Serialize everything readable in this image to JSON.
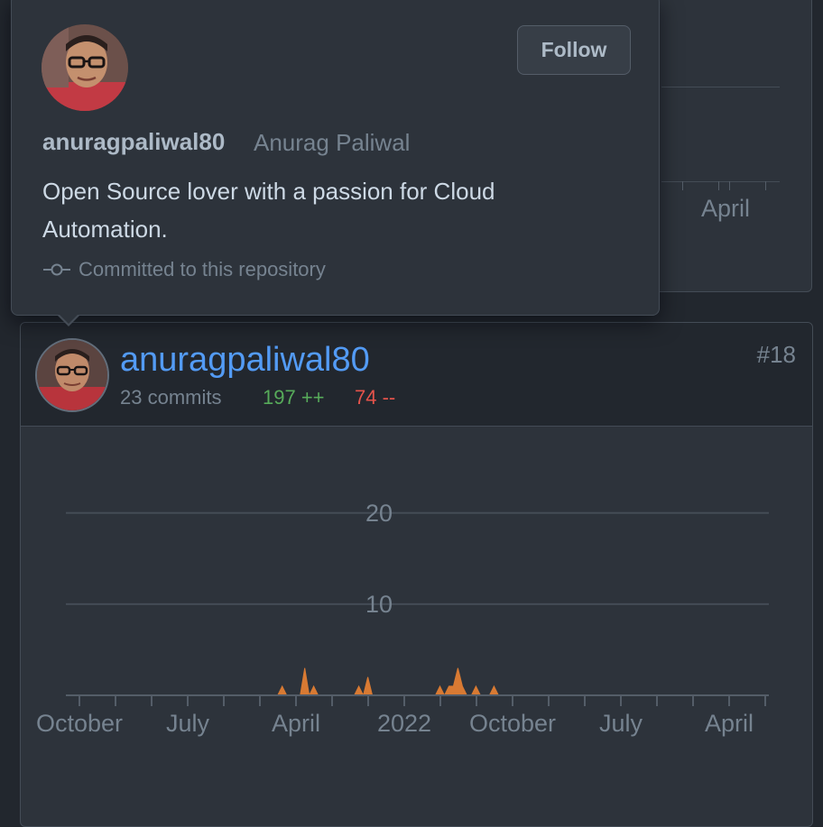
{
  "popover": {
    "login": "anuragpaliwal80",
    "name": "Anurag Paliwal",
    "bio": "Open Source lover with a passion for Cloud Automation.",
    "follow_label": "Follow",
    "commit_note": "Committed to this repository"
  },
  "background_card": {
    "month_label": "April"
  },
  "contributor": {
    "username": "anuragpaliwal80",
    "commits": "23 commits",
    "additions": "197 ++",
    "deletions": "74 --",
    "rank": "#18"
  },
  "colors": {
    "link": "#539bf5",
    "additions": "#57ab5a",
    "deletions": "#e5534b",
    "area": "#d87a33"
  },
  "chart_data": {
    "type": "area",
    "ylim": [
      0,
      25
    ],
    "y_ticks": [
      10,
      20
    ],
    "x_labels": [
      "October",
      "July",
      "April",
      "2022",
      "October",
      "July",
      "April"
    ],
    "x": [
      0,
      1,
      2,
      3,
      4,
      5,
      6,
      7,
      8,
      9,
      10,
      11,
      12,
      13,
      14,
      15,
      16,
      17,
      18,
      19,
      20,
      21,
      22,
      23,
      24,
      25,
      26,
      27,
      28,
      29,
      30,
      31,
      32,
      33,
      34,
      35,
      36,
      37,
      38,
      39,
      40,
      41,
      42,
      43,
      44,
      45,
      46,
      47,
      48,
      49,
      50,
      51,
      52,
      53,
      54,
      55,
      56,
      57,
      58,
      59,
      60,
      61,
      62,
      63,
      64,
      65,
      66,
      67,
      68,
      69,
      70,
      71,
      72,
      73,
      74,
      75,
      76,
      77,
      78,
      79,
      80,
      81,
      82,
      83,
      84,
      85,
      86,
      87,
      88,
      89,
      90,
      91,
      92,
      93,
      94,
      95,
      96,
      97,
      98,
      99,
      100,
      101,
      102,
      103,
      104,
      105,
      106,
      107,
      108,
      109,
      110,
      111,
      112,
      113,
      114,
      115,
      116,
      117,
      118,
      119,
      120,
      121,
      122,
      123,
      124,
      125,
      126,
      127,
      128,
      129,
      130,
      131,
      132,
      133,
      134,
      135,
      136,
      137,
      138,
      139,
      140,
      141,
      142,
      143,
      144,
      145,
      146,
      147,
      148,
      149,
      150,
      151,
      152,
      153,
      154,
      155,
      156
    ],
    "values": [
      0,
      0,
      0,
      0,
      0,
      0,
      0,
      0,
      0,
      0,
      0,
      0,
      0,
      0,
      0,
      0,
      0,
      0,
      0,
      0,
      0,
      0,
      0,
      0,
      0,
      0,
      0,
      0,
      0,
      0,
      0,
      0,
      0,
      0,
      0,
      0,
      0,
      0,
      0,
      0,
      0,
      0,
      0,
      0,
      0,
      0,
      0,
      0,
      1,
      0,
      0,
      0,
      0,
      3,
      0,
      1,
      0,
      0,
      0,
      0,
      0,
      0,
      0,
      0,
      0,
      1,
      0,
      2,
      0,
      0,
      0,
      0,
      0,
      0,
      0,
      0,
      0,
      0,
      0,
      0,
      0,
      0,
      0,
      1,
      0,
      1,
      1,
      3,
      1,
      0,
      0,
      1,
      0,
      0,
      0,
      1,
      0,
      0,
      0,
      0,
      0,
      0,
      0,
      0,
      0,
      0,
      0,
      0,
      0,
      0,
      0,
      0,
      0,
      0,
      0,
      0,
      0,
      0,
      0,
      0,
      0,
      0,
      0,
      0,
      0,
      0,
      0,
      0,
      0,
      0,
      0,
      0,
      0,
      0,
      0,
      0,
      0,
      0,
      0,
      0,
      0,
      0,
      0,
      0,
      0,
      0,
      0,
      0,
      0,
      0,
      0,
      0,
      0,
      0,
      0,
      0,
      0
    ]
  }
}
